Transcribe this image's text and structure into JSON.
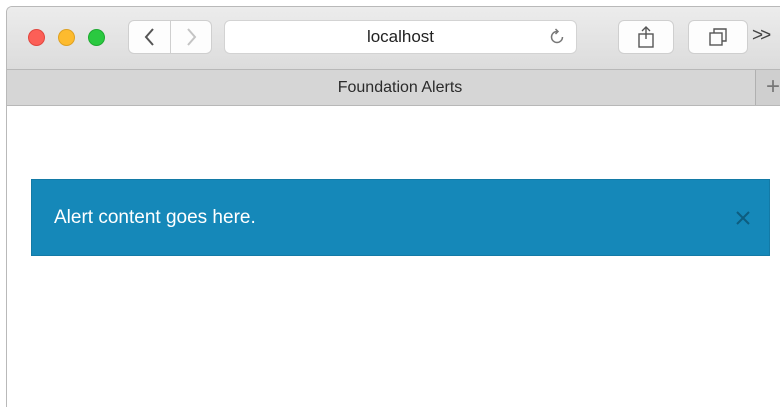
{
  "browser": {
    "address": "localhost",
    "tab_title": "Foundation Alerts",
    "new_tab_label": "+",
    "overflow_label": ">>"
  },
  "alert": {
    "message": "Alert content goes here.",
    "close_label": "×",
    "color": "#1588b9"
  },
  "icons": {
    "back": "chevron-left-icon",
    "forward": "chevron-right-icon",
    "reload": "reload-icon",
    "share": "share-icon",
    "tabs": "tabs-icon",
    "close": "close-icon"
  }
}
